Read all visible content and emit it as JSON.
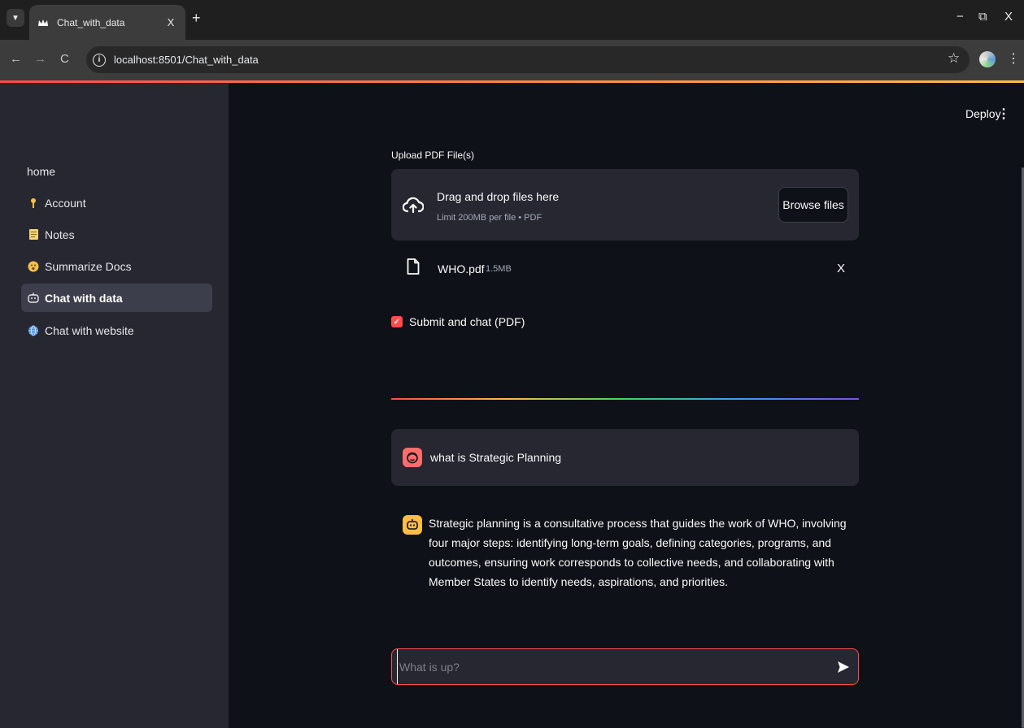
{
  "browser": {
    "tab_title": "Chat_with_data",
    "tab_close": "X",
    "new_tab": "+",
    "url": "localhost:8501/Chat_with_data",
    "win_minimize": "−",
    "win_restore": "⧉",
    "win_close": "X",
    "back": "←",
    "forward": "→",
    "reload": "C",
    "star": "☆",
    "kebab": "⋮"
  },
  "sidebar": {
    "items": [
      {
        "label": "home",
        "icon": ""
      },
      {
        "label": "Account",
        "icon": "key-icon"
      },
      {
        "label": "Notes",
        "icon": "notes-icon"
      },
      {
        "label": "Summarize Docs",
        "icon": "emoji-icon"
      },
      {
        "label": "Chat with data",
        "icon": "robot-icon",
        "active": true
      },
      {
        "label": "Chat with website",
        "icon": "globe-icon"
      }
    ]
  },
  "header": {
    "deploy_label": "Deploy",
    "menu_glyph": "⋮"
  },
  "uploader": {
    "label": "Upload PDF File(s)",
    "drop_title": "Drag and drop files here",
    "drop_subtitle": "Limit 200MB per file • PDF",
    "browse_label": "Browse files",
    "file_name": "WHO.pdf",
    "file_size": "1.5MB",
    "file_close": "X"
  },
  "checkbox": {
    "label": "Submit and chat (PDF)",
    "checked": true,
    "check_glyph": "✓"
  },
  "chat": {
    "user_message": "what is Strategic Planning",
    "bot_message": "Strategic planning is a consultative process that guides the work of WHO, involving four major steps: identifying long-term goals, defining categories, programs, and outcomes, ensuring work corresponds to collective needs, and collaborating with Member States to identify needs, aspirations, and priorities.",
    "input_placeholder": "What is up?",
    "input_value": ""
  },
  "colors": {
    "accent": "#ff4b4b",
    "sidebar_bg": "#262730",
    "main_bg": "#0e1117",
    "bot_avatar": "#ffbd45",
    "user_avatar": "#ff6c6c"
  }
}
